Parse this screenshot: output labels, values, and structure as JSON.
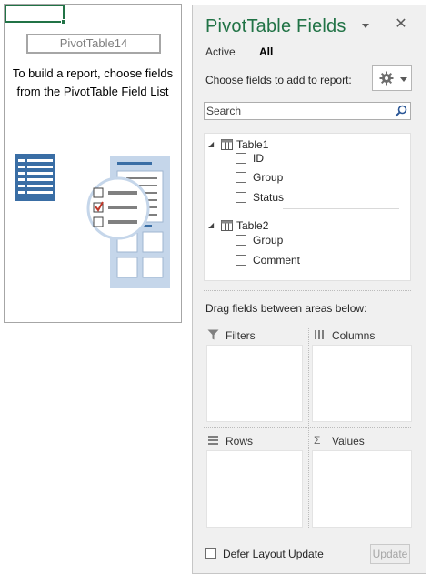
{
  "placeholder": {
    "pivot_name": "PivotTable14",
    "instruction": "To build a report, choose fields\nfrom the PivotTable Field List"
  },
  "panel": {
    "title": "PivotTable Fields",
    "tabs": [
      {
        "label": "Active"
      },
      {
        "label": "All"
      }
    ],
    "active_tab": "All",
    "choose_label": "Choose fields to add to report:",
    "search_placeholder": "Search",
    "tables": [
      {
        "name": "Table1",
        "expanded": true,
        "fields": [
          {
            "name": "ID",
            "checked": false
          },
          {
            "name": "Group",
            "checked": false
          },
          {
            "name": "Status",
            "checked": false
          }
        ]
      },
      {
        "name": "Table2",
        "expanded": true,
        "fields": [
          {
            "name": "Group",
            "checked": false
          },
          {
            "name": "Comment",
            "checked": false
          }
        ]
      }
    ],
    "drag_label": "Drag fields between areas below:",
    "areas": {
      "filters": "Filters",
      "columns": "Columns",
      "rows": "Rows",
      "values": "Values"
    },
    "defer_label": "Defer Layout Update",
    "defer_checked": false,
    "update_label": "Update"
  },
  "colors": {
    "accent": "#217346",
    "panel_bg": "#f0f0f0",
    "illustration_blue": "#3a6ea5",
    "illustration_light": "#c5d6ea",
    "check_red": "#c0392b"
  },
  "icons": {
    "title_dropdown": "chevron-down-icon",
    "close": "close-icon",
    "tools": "gear-icon",
    "search": "search-icon",
    "table": "table-icon",
    "expand": "collapse-triangle-icon",
    "filters": "filter-icon",
    "columns": "columns-icon",
    "rows": "rows-icon",
    "values": "sigma-icon"
  }
}
